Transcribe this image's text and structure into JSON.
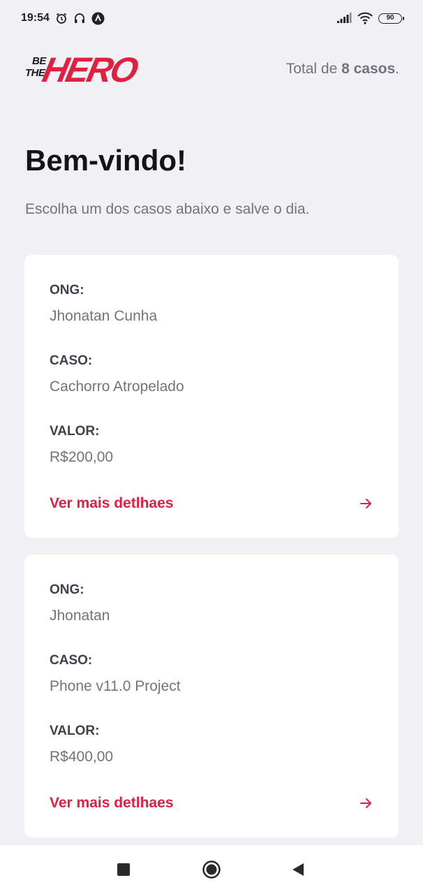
{
  "status_bar": {
    "time": "19:54",
    "battery": "90",
    "icons": [
      "alarm-icon",
      "headset-icon",
      "notification-icon",
      "signal-icon",
      "wifi-icon",
      "battery-icon"
    ]
  },
  "header": {
    "logo": {
      "be": "BE",
      "the": "THE",
      "hero": "HERO"
    },
    "total_prefix": "Total de ",
    "total_count": "8 casos",
    "total_suffix": "."
  },
  "page": {
    "title": "Bem-vindo!",
    "subtitle": "Escolha um dos casos abaixo e salve o dia."
  },
  "incidents": [
    {
      "ong_label": "ONG:",
      "ong_value": "Jhonatan Cunha",
      "caso_label": "CASO:",
      "caso_value": "Cachorro Atropelado",
      "valor_label": "VALOR:",
      "valor_value": "R$200,00",
      "details_label": "Ver mais detlhaes"
    },
    {
      "ong_label": "ONG:",
      "ong_value": "Jhonatan",
      "caso_label": "CASO:",
      "caso_value": "Phone v11.0 Project",
      "valor_label": "VALOR:",
      "valor_value": "R$400,00",
      "details_label": "Ver mais detlhaes"
    }
  ],
  "colors": {
    "accent": "#e02041",
    "background": "#f0f0f5",
    "text_dark": "#13131a",
    "text_muted": "#737380"
  },
  "nav_bar": {
    "icons": [
      "recents-square-icon",
      "home-circle-icon",
      "back-triangle-icon"
    ]
  }
}
